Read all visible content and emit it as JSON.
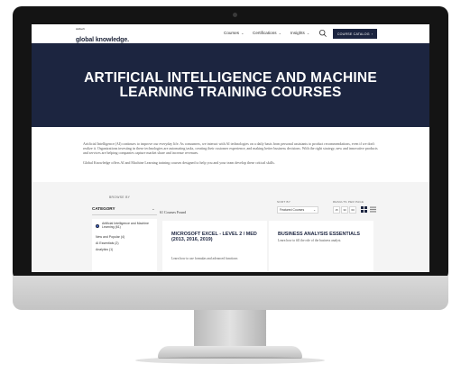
{
  "nav": {
    "logo_small": "skillsoft",
    "logo_main": "global knowledge.",
    "items": [
      "Courses",
      "Certifications",
      "Insights"
    ],
    "catalog_button": "COURSE CATALOG"
  },
  "hero": {
    "title": "ARTIFICIAL INTELLIGENCE AND MACHINE LEARNING TRAINING COURSES"
  },
  "intro": {
    "paragraph1": "Artificial Intelligence (AI) continues to improve our everyday life. As consumers, we interact with AI technologies on a daily basis from personal assistants to product recommendations, even if we don't realize it. Organizations investing in these technologies are automating tasks, creating their customer experience, and making better business decisions. With the right strategy, new and innovative products and services are helping companies capture market share and increase revenues.",
    "paragraph2": "Global Knowledge offers AI and Machine Learning training courses designed to help you and your team develop these critical skills."
  },
  "filters": {
    "browse_label": "BROWSE BY",
    "category_header": "CATEGORY",
    "categories": [
      "Artificial Intelligence and Machine Learning (61)",
      "New and Popular (4)",
      "AI Essentials (2)",
      "Analytics (1)"
    ]
  },
  "results": {
    "count_text": "61 Courses Found",
    "sort_label": "SORT BY",
    "sort_value": "Featured Courses",
    "rpp_label": "RESULTS PER PAGE",
    "rpp_options": [
      "15",
      "30",
      "60"
    ]
  },
  "cards": [
    {
      "title": "MICROSOFT EXCEL - LEVEL 2 / MED (2013, 2016, 2019)",
      "desc": "Learn how to use formulas and advanced functions"
    },
    {
      "title": "BUSINESS ANALYSIS ESSENTIALS",
      "desc": "Learn how to fill the role of the business analyst."
    }
  ],
  "icons": {
    "search": "search-icon",
    "arrow": "arrow-right-icon",
    "chevron": "chevron-down-icon",
    "grid": "grid-view-icon",
    "list": "list-view-icon"
  },
  "colors": {
    "brand_navy": "#1c2540",
    "accent_blue": "#4a6fd6"
  }
}
